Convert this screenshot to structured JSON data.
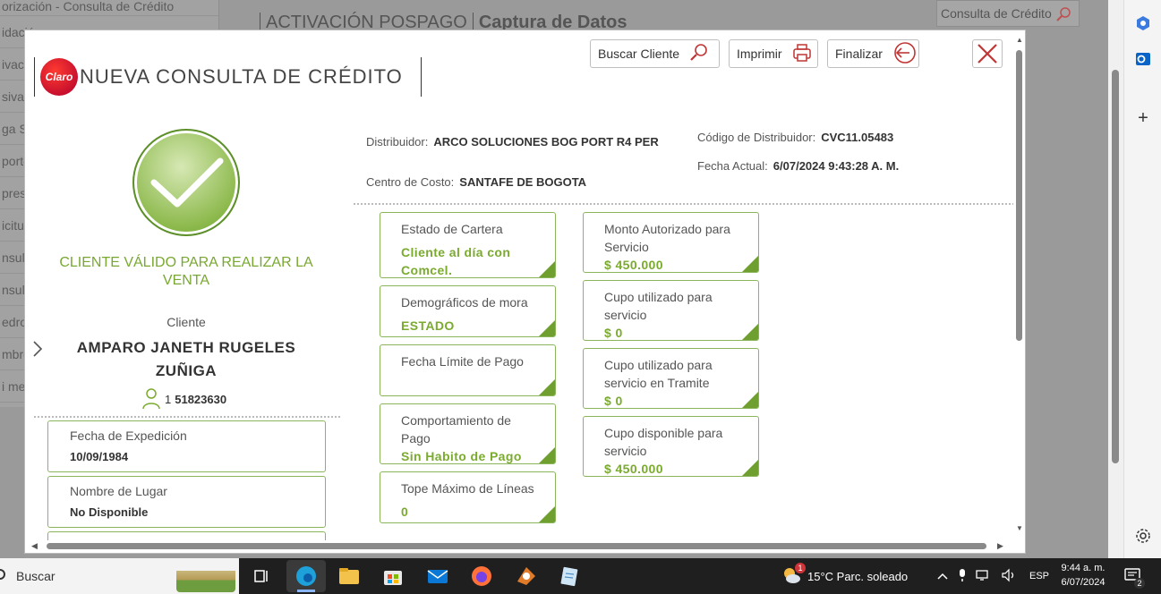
{
  "background": {
    "sidebar_items": [
      "orización - Consulta de Crédito",
      "idación",
      "ivación",
      "sivas",
      "ga S",
      "porte",
      "presió",
      "icitud",
      "nsult",
      "nsult",
      "edro",
      "mbre",
      "i mer"
    ],
    "header_segments": [
      "ACTIVACIÓN POSPAGO",
      "Captura de Datos"
    ],
    "consulta_button": "Consulta de Crédito"
  },
  "modal": {
    "logo_text": "Claro",
    "title": "NUEVA CONSULTA DE CRÉDITO",
    "buttons": {
      "buscar_cliente": "Buscar Cliente",
      "imprimir": "Imprimir",
      "finalizar": "Finalizar"
    },
    "status_text": "CLIENTE VÁLIDO PARA REALIZAR LA VENTA",
    "cliente_label": "Cliente",
    "cliente_name": "AMPARO JANETH RUGELES ZUÑIGA",
    "cliente_doc_type": "1",
    "cliente_doc_number": "51823630",
    "left_boxes": [
      {
        "label": "Fecha de Expedición",
        "value": "10/09/1984"
      },
      {
        "label": "Nombre de Lugar",
        "value": "No Disponible"
      }
    ],
    "distribuidor": {
      "label": "Distribuidor:",
      "value": "ARCO SOLUCIONES BOG PORT R4 PER",
      "codigo_label": "Código de Distribuidor:",
      "codigo_value": "CVC11.05483",
      "fecha_label": "Fecha Actual:",
      "fecha_value": "6/07/2024 9:43:28 A. M.",
      "centro_label": "Centro de Costo:",
      "centro_value": "SANTAFE DE BOGOTA"
    },
    "cards_left": [
      {
        "label": "Estado de Cartera",
        "value": "Cliente al día con Comcel."
      },
      {
        "label": "Demográficos de mora",
        "value": "ESTADO"
      },
      {
        "label": "Fecha Límite de Pago",
        "value": ""
      },
      {
        "label": "Comportamiento de Pago",
        "value": "Sin Habito de Pago"
      },
      {
        "label": "Tope Máximo de Líneas",
        "value": "0"
      }
    ],
    "cards_right": [
      {
        "label": "Monto Autorizado para Servicio",
        "value": "$ 450.000"
      },
      {
        "label": "Cupo utilizado para servicio",
        "value": "$ 0"
      },
      {
        "label": "Cupo utilizado para servicio en Tramite",
        "value": "$ 0"
      },
      {
        "label": "Cupo disponible para servicio",
        "value": "$ 450.000"
      }
    ]
  },
  "taskbar": {
    "search_label": "Buscar",
    "weather": "15°C  Parc. soleado",
    "weather_badge": "1",
    "language": "ESP",
    "time": "9:44 a. m.",
    "date": "6/07/2024",
    "notifications": "2"
  },
  "colors": {
    "accent_green": "#7aab2e",
    "border_green": "#8ab55a",
    "claro_red": "#c8102e"
  }
}
